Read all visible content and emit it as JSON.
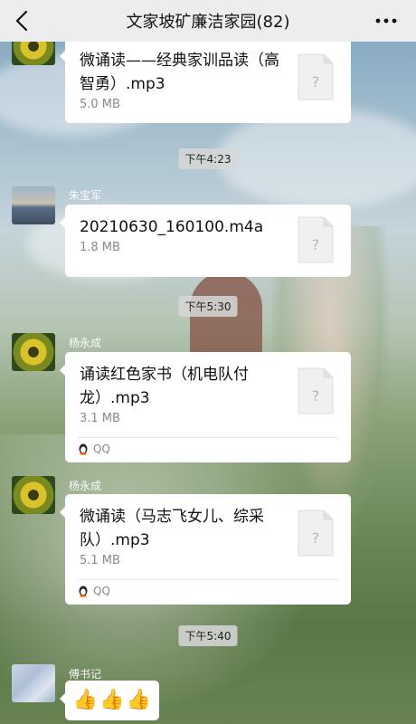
{
  "header": {
    "title": "文家坡矿廉洁家园(82)"
  },
  "messages": [
    {
      "file_name": "微诵读——经典家训品读（高智勇）.mp3",
      "file_size": "5.0 MB"
    },
    {
      "time": "下午4:23",
      "sender": "朱宝军",
      "file_name": "20210630_160100.m4a",
      "file_size": "1.8 MB"
    },
    {
      "time": "下午5:30",
      "sender": "杨永成",
      "file_name": "诵读红色家书（机电队付龙）.mp3",
      "file_size": "3.1 MB",
      "source": "QQ"
    },
    {
      "sender": "杨永成",
      "file_name": "微诵读（马志飞女儿、综采队）.mp3",
      "file_size": "5.1 MB",
      "source": "QQ"
    },
    {
      "time": "下午5:40",
      "sender": "傅书记",
      "emoji": [
        "👍",
        "👍",
        "👍"
      ]
    }
  ],
  "icons": {
    "back": "back-chevron-icon",
    "more": "more-dots-icon",
    "file": "unknown-file-icon",
    "source": "qq-penguin-icon",
    "thumb": "thumbs-up-emoji"
  },
  "colors": {
    "header_bg": "#ededed",
    "bubble_bg": "#ffffff",
    "time_bg": "#d7d7d7"
  }
}
